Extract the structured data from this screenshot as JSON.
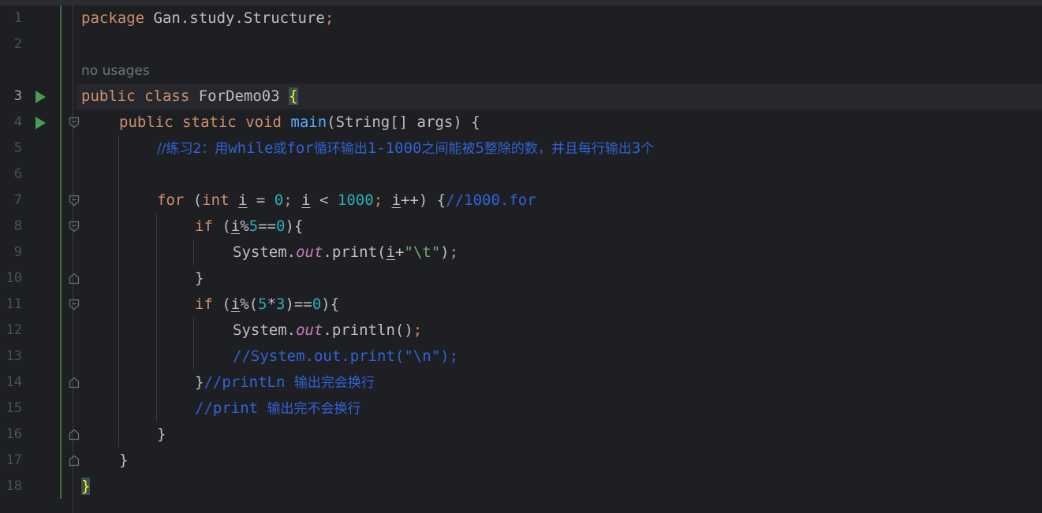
{
  "hint": "no usages",
  "line_numbers": [
    "1",
    "2",
    "3",
    "4",
    "5",
    "6",
    "7",
    "8",
    "9",
    "10",
    "11",
    "12",
    "13",
    "14",
    "15",
    "16",
    "17",
    "18"
  ],
  "code": {
    "l1": {
      "kw": "package",
      "text": " Gan.study.Structure",
      "semi": ";"
    },
    "l3": {
      "kw1": "public",
      "kw2": "class",
      "name": " ForDemo03 ",
      "brace": "{"
    },
    "l4": {
      "kw1": "public",
      "kw2": "static",
      "kw3": "void",
      "fn": "main",
      "rest": "(String[] args) {"
    },
    "l5": {
      "c1": "//练习2：用",
      "c2": "while",
      "c3": "或",
      "c4": "for",
      "c5": "循环输出",
      "c6": "1-1000",
      "c7": "之间能被",
      "c8": "5",
      "c9": "整除的数，并且每行输出",
      "c10": "3",
      "c11": "个"
    },
    "l7": {
      "kw1": "for",
      "p1": " (",
      "kw2": "int",
      "sp1": " ",
      "v1": "i",
      "p2": " = ",
      "n1": "0",
      "s1": ";",
      "sp2": " ",
      "v2": "i",
      "p3": " < ",
      "n2": "1000",
      "s2": ";",
      "sp3": " ",
      "v3": "i",
      "p4": "++) {",
      "cm": "//1000.for"
    },
    "l8": {
      "kw": "if",
      "p1": " (",
      "v": "i",
      "p2": "%",
      "n1": "5",
      "p3": "==",
      "n2": "0",
      "p4": "){"
    },
    "l9": {
      "t1": "System.",
      "f": "out",
      "t2": ".print(",
      "v": "i",
      "t3": "+",
      "str": "\"\\t\"",
      "t4": ")",
      "semi": ";"
    },
    "l10": {
      "t": "}"
    },
    "l11": {
      "kw": "if",
      "p1": " (",
      "v": "i",
      "p2": "%(",
      "n1": "5",
      "p3": "*",
      "n2": "3",
      "p4": ")==",
      "n3": "0",
      "p5": "){"
    },
    "l12": {
      "t1": "System.",
      "f": "out",
      "t2": ".println()",
      "semi": ";"
    },
    "l13": {
      "cm": "//System.out.print(\"\\n\");"
    },
    "l14": {
      "t": "}",
      "cm1": "//printLn ",
      "cm2": "输出完会换行"
    },
    "l15": {
      "cm1": "//print ",
      "cm2": "输出完不会换行"
    },
    "l16": {
      "t": "}"
    },
    "l17": {
      "t": "}"
    },
    "l18": {
      "brace": "}"
    }
  }
}
